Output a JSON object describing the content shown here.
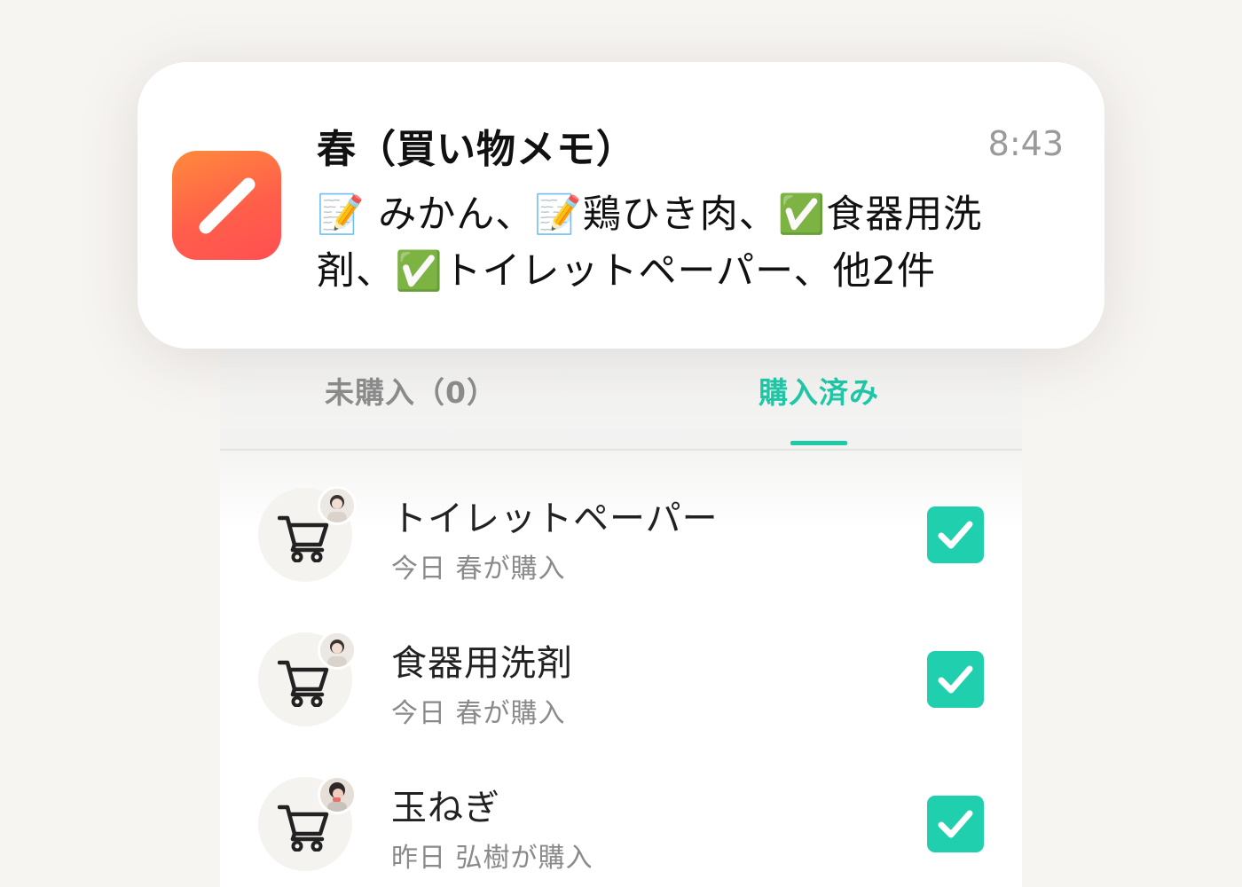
{
  "notification": {
    "app_icon": "pencil-app-icon",
    "title": "春（買い物メモ）",
    "time": "8:43",
    "body": "📝 みかん、📝鶏ひき肉、✅食器用洗剤、✅トイレットペーパー、他2件"
  },
  "tabs": {
    "unpurchased": "未購入（0）",
    "purchased": "購入済み",
    "active": "purchased"
  },
  "items": [
    {
      "title": "トイレットペーパー",
      "subtitle": "今日 春が購入",
      "checked": true,
      "icon": "cart-icon"
    },
    {
      "title": "食器用洗剤",
      "subtitle": "今日 春が購入",
      "checked": true,
      "icon": "cart-icon"
    },
    {
      "title": "玉ねぎ",
      "subtitle": "昨日 弘樹が購入",
      "checked": true,
      "icon": "cart-icon"
    }
  ],
  "colors": {
    "accent": "#1fc9a8",
    "checkbox": "#1fcfae",
    "app_icon_gradient_start": "#ff8a3c",
    "app_icon_gradient_end": "#ff4f52",
    "background": "#f7f5f2"
  }
}
